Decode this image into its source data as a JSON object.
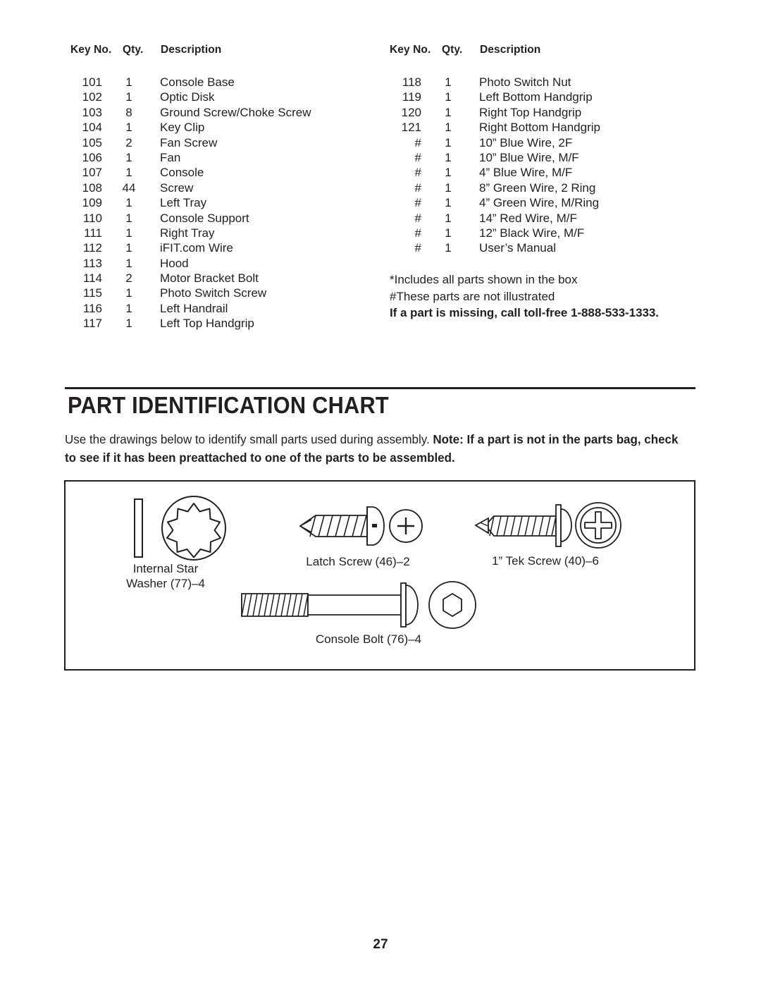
{
  "parts_list": {
    "columns": [
      "Key No.",
      "Qty.",
      "Description"
    ],
    "left_rows": [
      {
        "key": "101",
        "qty": "1",
        "desc": "Console Base"
      },
      {
        "key": "102",
        "qty": "1",
        "desc": "Optic Disk"
      },
      {
        "key": "103",
        "qty": "8",
        "desc": "Ground Screw/Choke Screw"
      },
      {
        "key": "104",
        "qty": "1",
        "desc": "Key Clip"
      },
      {
        "key": "105",
        "qty": "2",
        "desc": "Fan Screw"
      },
      {
        "key": "106",
        "qty": "1",
        "desc": "Fan"
      },
      {
        "key": "107",
        "qty": "1",
        "desc": "Console"
      },
      {
        "key": "108",
        "qty": "44",
        "desc": "Screw"
      },
      {
        "key": "109",
        "qty": "1",
        "desc": "Left Tray"
      },
      {
        "key": "110",
        "qty": "1",
        "desc": "Console Support"
      },
      {
        "key": "111",
        "qty": "1",
        "desc": "Right Tray"
      },
      {
        "key": "112",
        "qty": "1",
        "desc": "iFIT.com Wire"
      },
      {
        "key": "113",
        "qty": "1",
        "desc": "Hood"
      },
      {
        "key": "114",
        "qty": "2",
        "desc": "Motor Bracket Bolt"
      },
      {
        "key": "115",
        "qty": "1",
        "desc": "Photo Switch Screw"
      },
      {
        "key": "116",
        "qty": "1",
        "desc": "Left Handrail"
      },
      {
        "key": "117",
        "qty": "1",
        "desc": "Left Top Handgrip"
      }
    ],
    "right_rows": [
      {
        "key": "118",
        "qty": "1",
        "desc": "Photo Switch Nut"
      },
      {
        "key": "119",
        "qty": "1",
        "desc": "Left Bottom Handgrip"
      },
      {
        "key": "120",
        "qty": "1",
        "desc": "Right Top Handgrip"
      },
      {
        "key": "121",
        "qty": "1",
        "desc": "Right Bottom Handgrip"
      },
      {
        "key": "#",
        "qty": "1",
        "desc": "10” Blue Wire, 2F"
      },
      {
        "key": "#",
        "qty": "1",
        "desc": "10” Blue Wire, M/F"
      },
      {
        "key": "#",
        "qty": "1",
        "desc": "4” Blue Wire, M/F"
      },
      {
        "key": "#",
        "qty": "1",
        "desc": "8” Green Wire, 2 Ring"
      },
      {
        "key": "#",
        "qty": "1",
        "desc": "4” Green Wire, M/Ring"
      },
      {
        "key": "#",
        "qty": "1",
        "desc": "14” Red Wire, M/F"
      },
      {
        "key": "#",
        "qty": "1",
        "desc": "12” Black Wire, M/F"
      },
      {
        "key": "#",
        "qty": "1",
        "desc": "User’s Manual"
      }
    ],
    "notes": {
      "line1": "*Includes all parts shown in the box",
      "line2": "#These parts are not illustrated",
      "line3": "If a part is missing, call toll-free 1-888-533-1333."
    }
  },
  "section": {
    "title": "PART IDENTIFICATION CHART",
    "intro_plain_1": "Use the drawings below to identify small parts used during assembly. ",
    "intro_bold_1": "Note: If a part is not in the parts bag, check to see if it has been preattached to one of the parts to be assembled."
  },
  "part_chart": {
    "figures": [
      {
        "name": "internal-star-washer",
        "caption_line1": "Internal Star",
        "caption_line2": "Washer (77)–4"
      },
      {
        "name": "latch-screw",
        "caption_line1": "Latch Screw (46)–2",
        "caption_line2": ""
      },
      {
        "name": "tek-screw",
        "caption_line1": "1” Tek Screw (40)–6",
        "caption_line2": ""
      },
      {
        "name": "console-bolt",
        "caption_line1": "Console Bolt (76)–4",
        "caption_line2": ""
      }
    ]
  },
  "page": {
    "number": "27"
  },
  "colors": {
    "ink": "#231f20",
    "paper": "#ffffff"
  }
}
